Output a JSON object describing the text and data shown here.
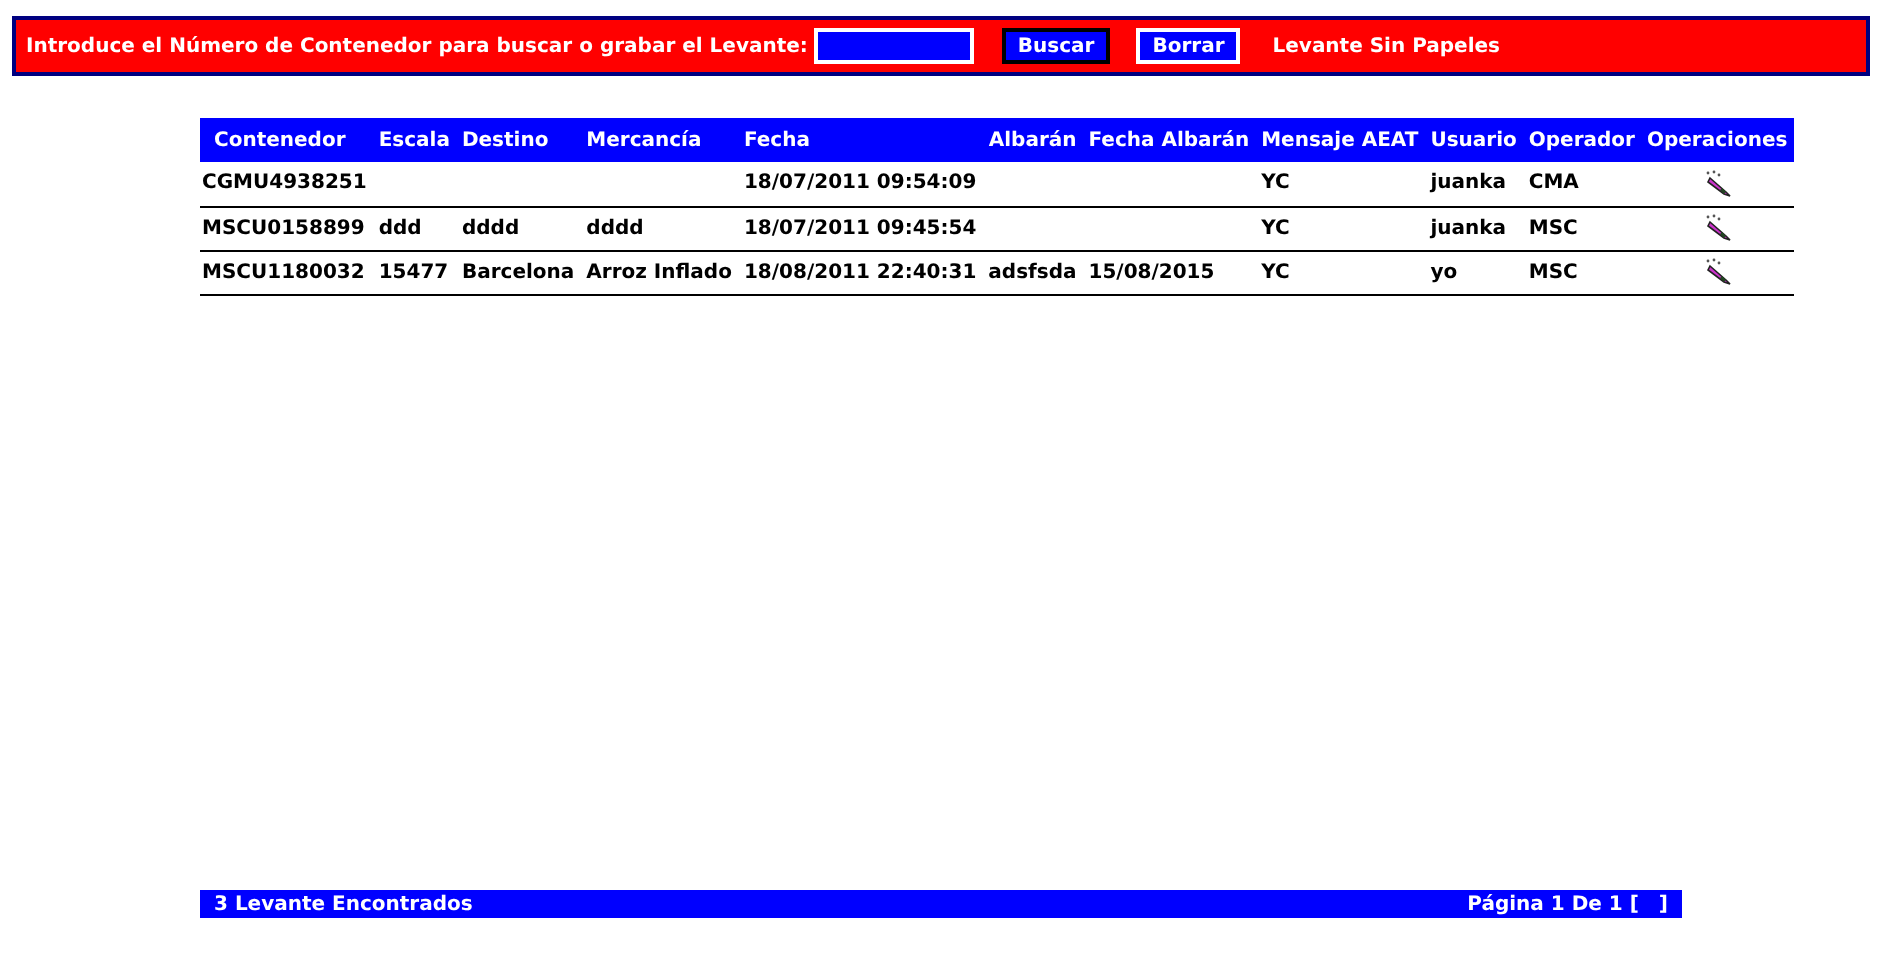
{
  "search_bar": {
    "label": "Introduce el Número de Contenedor para buscar o grabar el Levante:",
    "buttons": [
      "Buscar",
      "Borrar"
    ],
    "link": "Levante Sin Papeles"
  },
  "table": {
    "columns": [
      "Contenedor",
      "Escala",
      "Destino",
      "Mercancía",
      "Fecha",
      "Albarán",
      "Fecha Albarán",
      "Mensaje AEAT",
      "Usuario",
      "Operador",
      "Operaciones"
    ],
    "rows": [
      [
        "CGMU4938251",
        "",
        "",
        "",
        "18/07/2011 09:54:09",
        "",
        "",
        "YC",
        "juanka",
        "CMA"
      ],
      [
        "MSCU0158899",
        "ddd",
        "dddd",
        "dddd",
        "18/07/2011 09:45:54",
        "",
        "",
        "YC",
        "juanka",
        "MSC"
      ],
      [
        "MSCU1180032",
        "15477",
        "Barcelona",
        "Arroz Inflado",
        "18/08/2011 22:40:31",
        "adsfsda",
        "15/08/2015",
        "YC",
        "yo",
        "MSC"
      ]
    ]
  },
  "footer": {
    "count": "3 Levante Encontrados",
    "pagination": "Página 1 De 1 [",
    "bracket": "]"
  }
}
